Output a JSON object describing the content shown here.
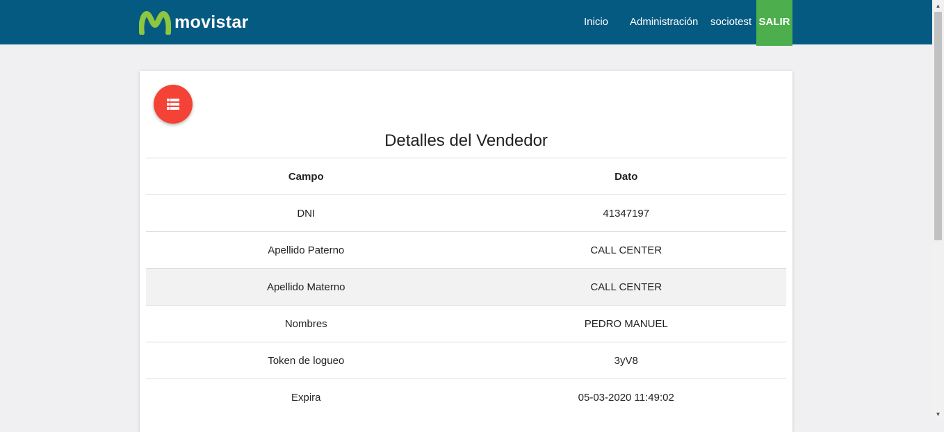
{
  "navbar": {
    "brand": "movistar",
    "items": [
      "Inicio",
      "Administración",
      "sociotest"
    ],
    "logout": "SALIR",
    "colors": {
      "background": "#055a82",
      "logout": "#4cae4c",
      "brand_mark": "#8dc63f"
    }
  },
  "card": {
    "fab_icon": "list-icon",
    "fab_color": "#f44336",
    "title": "Detalles del Vendedor",
    "table": {
      "headers": [
        "Campo",
        "Dato"
      ],
      "rows": [
        [
          "DNI",
          "41347197"
        ],
        [
          "Apellido Paterno",
          "CALL CENTER"
        ],
        [
          "Apellido Materno",
          "CALL CENTER"
        ],
        [
          "Nombres",
          "PEDRO MANUEL"
        ],
        [
          "Token de logueo",
          "3yV8"
        ],
        [
          "Expira",
          "05-03-2020 11:49:02"
        ]
      ]
    }
  }
}
